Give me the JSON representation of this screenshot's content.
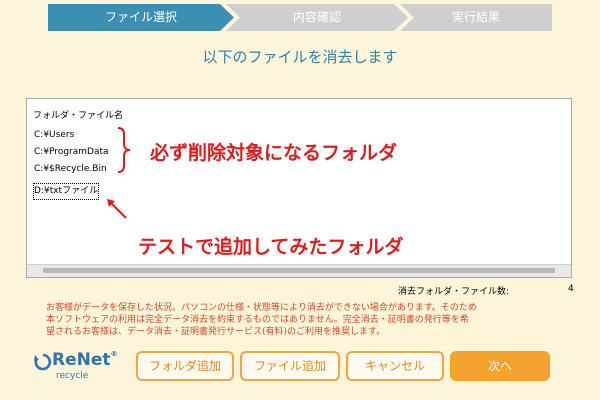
{
  "steps": [
    {
      "label": "ファイル選択",
      "active": true
    },
    {
      "label": "内容確認",
      "active": false
    },
    {
      "label": "実行結果",
      "active": false
    }
  ],
  "heading": "以下のファイルを消去します",
  "file_list": {
    "column_header": "フォルダ・ファイル名",
    "entries": [
      "C:¥Users",
      "C:¥ProgramData",
      "C:¥$Recycle.Bin",
      "D:¥txtファイル"
    ]
  },
  "annotations": {
    "required": "必ず削除対象になるフォルダ",
    "test": "テストで追加してみたフォルダ"
  },
  "count": {
    "label": "消去フォルダ・ファイル数:",
    "value": "4"
  },
  "notice": [
    "お客様がデータを保存した状況、パソコンの仕様・状態等により消去ができない場合があります。そのため",
    "本ソフトウェアの利用は完全データ消去を約束するものではありません。完全消去・証明書の発行等を希",
    "望されるお客様は、データ消去・証明書発行サービス(有料)のご利用を推奨します。"
  ],
  "logo": {
    "main": "ReNet",
    "sub": "recycle",
    "mark": "®"
  },
  "buttons": {
    "add_folder": "フォルダ追加",
    "add_file": "ファイル追加",
    "cancel": "キャンセル",
    "next": "次へ"
  },
  "colors": {
    "background": "#fdf5d9",
    "step_active": "#3b8fb3",
    "step_inactive": "#cfcfcf",
    "annotation": "#e01b1b",
    "button_border": "#f0a641",
    "button_primary": "#f4a32f",
    "notice_text": "#d94a2b"
  }
}
